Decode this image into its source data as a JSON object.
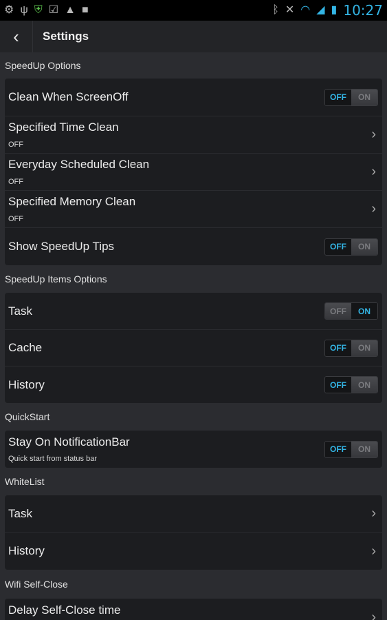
{
  "status_bar": {
    "left_icons": [
      "android-icon",
      "usb-icon",
      "shield-icon",
      "calendar-check-icon",
      "warning-icon",
      "bag-icon"
    ],
    "right_icons": [
      "bluetooth-icon",
      "mute-icon",
      "wifi-icon",
      "signal-icon",
      "battery-icon"
    ],
    "clock": "10:27"
  },
  "action_bar": {
    "title": "Settings"
  },
  "toggle_labels": {
    "off": "OFF",
    "on": "ON"
  },
  "sections": {
    "speedup": {
      "header": "SpeedUp Options",
      "clean_when_screenoff": {
        "label": "Clean When ScreenOff",
        "state": "off"
      },
      "specified_time_clean": {
        "label": "Specified Time Clean",
        "sub": "OFF"
      },
      "everyday_scheduled_clean": {
        "label": "Everyday Scheduled Clean",
        "sub": "OFF"
      },
      "specified_memory_clean": {
        "label": "Specified Memory Clean",
        "sub": "OFF"
      },
      "show_speedup_tips": {
        "label": "Show SpeedUp Tips",
        "state": "off"
      }
    },
    "items": {
      "header": "SpeedUp Items Options",
      "task": {
        "label": "Task",
        "state": "on"
      },
      "cache": {
        "label": "Cache",
        "state": "off"
      },
      "history": {
        "label": "History",
        "state": "off"
      }
    },
    "quickstart": {
      "header": "QuickStart",
      "stay_on_notificationbar": {
        "label": "Stay On NotificationBar",
        "sub": "Quick start from status bar",
        "state": "off"
      }
    },
    "whitelist": {
      "header": "WhiteList",
      "task": {
        "label": "Task"
      },
      "history": {
        "label": "History"
      }
    },
    "wifi": {
      "header": "Wifi Self-Close",
      "delay_self_close_time": {
        "label": "Delay Self-Close time"
      }
    }
  },
  "colors": {
    "accent": "#33b5e5",
    "background": "#2b2c30",
    "card": "#1c1d20"
  }
}
